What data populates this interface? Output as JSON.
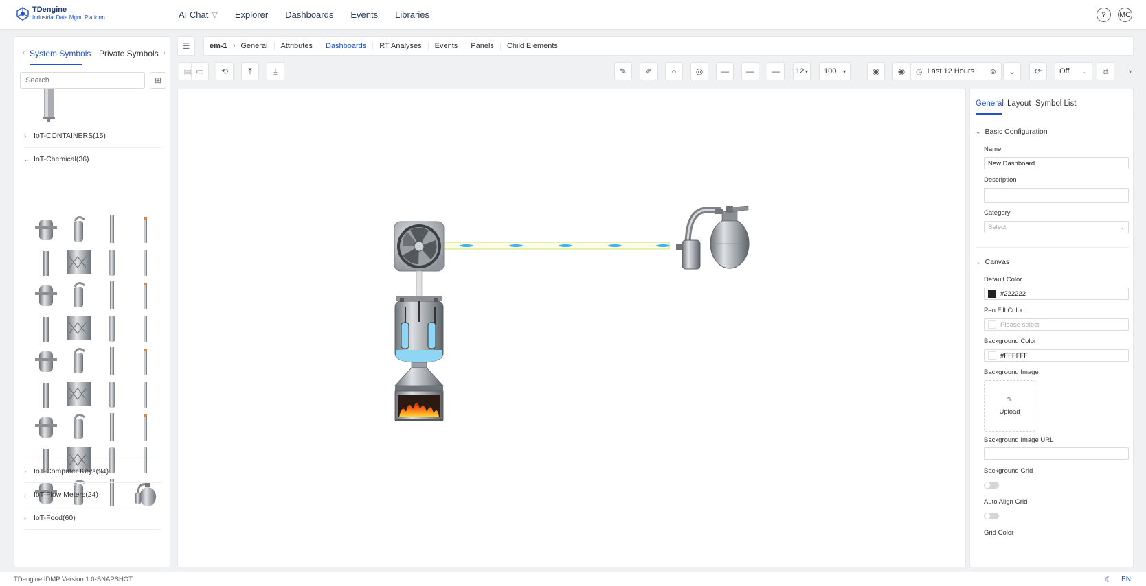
{
  "app": {
    "logo_name": "TDengine",
    "logo_subtitle": "Industrial Data Mgmt Platform",
    "brand_color": "#2253c7"
  },
  "nav": {
    "items": [
      "AI Chat",
      "Explorer",
      "Dashboards",
      "Events",
      "Libraries"
    ],
    "help_label": "?",
    "user_initials": "MC"
  },
  "symbols_panel": {
    "tabs": [
      "System Symbols",
      "Private Symbols"
    ],
    "active_tab": "System Symbols",
    "search_placeholder": "Search",
    "groups_top": [
      {
        "label": "IoT-CONTAINERS(15)",
        "expanded": false
      },
      {
        "label": "IoT-Chemical(36)",
        "expanded": true
      }
    ],
    "groups_bottom": [
      {
        "label": "IoT-Computer Keys(94)",
        "expanded": false
      },
      {
        "label": "IoT-Flow Meters(24)",
        "expanded": false
      },
      {
        "label": "IoT-Food(60)",
        "expanded": false
      }
    ],
    "chemical_symbol_count_visible": 36
  },
  "breadcrumb": {
    "root": "em-1",
    "tabs": [
      "General",
      "Attributes",
      "Dashboards",
      "RT Analyses",
      "Events",
      "Panels",
      "Child Elements"
    ],
    "active_tab": "Dashboards"
  },
  "toolbar": {
    "line_width_1": "—",
    "line_width_2": "—",
    "line_width_3": "—",
    "font_size": "12",
    "zoom": "100",
    "time_range": "Last 12 Hours",
    "refresh": "Off"
  },
  "config": {
    "tabs": [
      "General",
      "Layout",
      "Symbol List"
    ],
    "active_tab": "General",
    "basic_section": "Basic Configuration",
    "name_label": "Name",
    "name_value": "New Dashboard",
    "description_label": "Description",
    "category_label": "Category",
    "category_placeholder": "Select",
    "canvas_section": "Canvas",
    "default_color_label": "Default Color",
    "default_color_value": "#222222",
    "pen_fill_label": "Pen Fill Color",
    "pen_fill_placeholder": "Please select",
    "bg_color_label": "Background Color",
    "bg_color_value": "#FFFFFF",
    "bg_image_label": "Background Image",
    "upload_label": "Upload",
    "bg_image_url_label": "Background Image URL",
    "bg_grid_label": "Background Grid",
    "bg_grid_on": false,
    "auto_align_label": "Auto Align Grid",
    "auto_align_on": false,
    "grid_color_label": "Grid Color"
  },
  "footer": {
    "version": "TDengine IDMP Version 1.0-SNAPSHOT",
    "lang": "EN"
  }
}
